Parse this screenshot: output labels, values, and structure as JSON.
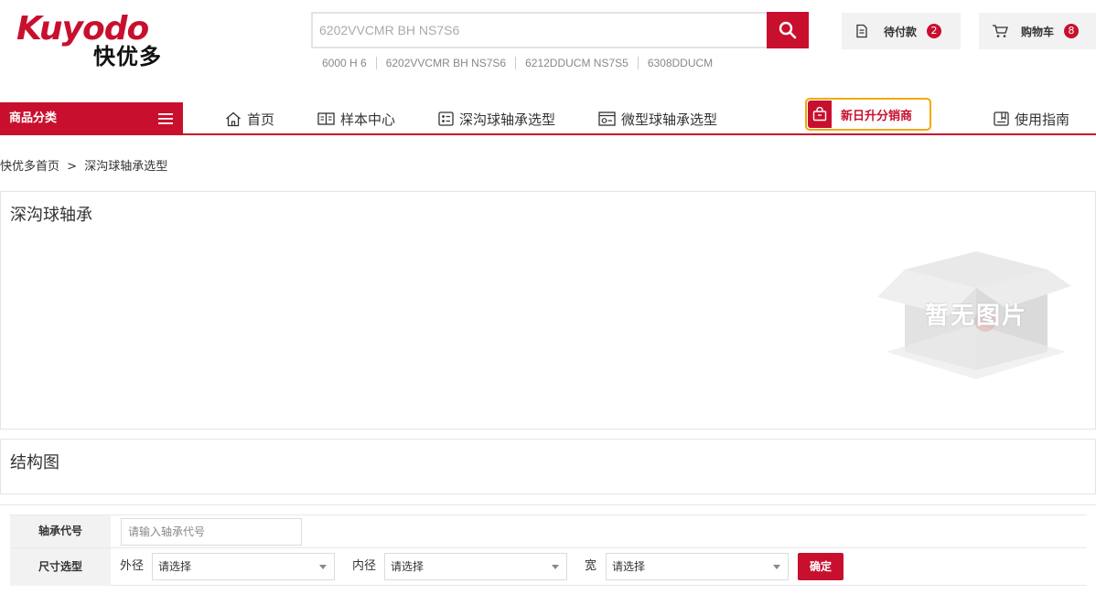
{
  "logo": {
    "en": "Kuyodo",
    "cn": "快优多"
  },
  "search": {
    "placeholder": "6202VVCMR BH NS7S6"
  },
  "hot_words": [
    "6000 H 6",
    "6202VVCMR BH NS7S6",
    "6212DDUCM NS7S5",
    "6308DDUCM"
  ],
  "header": {
    "pending_label": "待付款",
    "pending_count": "2",
    "cart_label": "购物车",
    "cart_count": "8"
  },
  "nav": {
    "category_label": "商品分类",
    "items": [
      "首页",
      "样本中心",
      "深沟球轴承选型",
      "微型球轴承选型"
    ],
    "promo": "新日升分销商",
    "guide": "使用指南"
  },
  "breadcrumb": {
    "home": "快优多首页",
    "sep": ">",
    "current": "深沟球轴承选型"
  },
  "panel1": {
    "title": "深沟球轴承",
    "no_image_text": "暂无图片"
  },
  "panel2": {
    "title": "结构图"
  },
  "form": {
    "code_label": "轴承代号",
    "code_placeholder": "请输入轴承代号",
    "size_label": "尺寸选型",
    "outer_label": "外径",
    "inner_label": "内径",
    "width_label": "宽",
    "select_placeholder": "请选择",
    "confirm": "确定"
  },
  "colors": {
    "brand": "#c8102e",
    "promo_border": "#f2a900"
  }
}
